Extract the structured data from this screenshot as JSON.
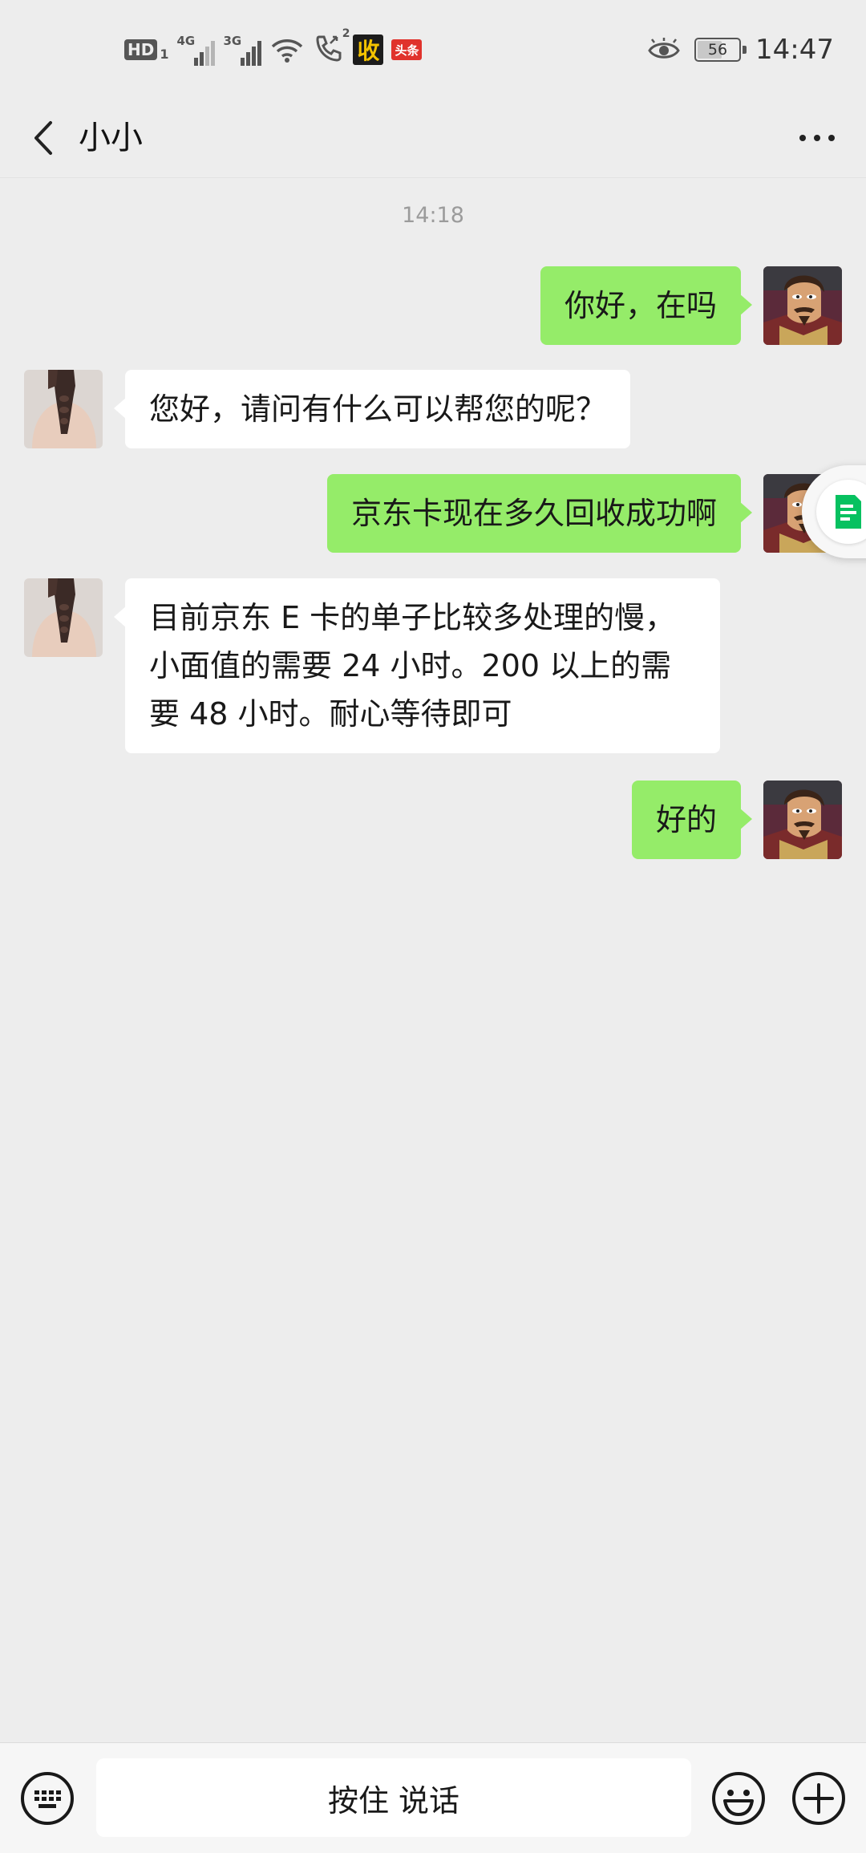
{
  "status_bar": {
    "hd_label": "HD",
    "hd_sim": "1",
    "signal1_gen": "4G",
    "signal2_gen": "3G",
    "call_badge": "2",
    "app_icon_1": "收",
    "app_icon_2": "头条",
    "battery_level": "56",
    "time": "14:47"
  },
  "header": {
    "title": "小小"
  },
  "chat": {
    "time_divider": "14:18",
    "messages": [
      {
        "side": "self",
        "text": "你好，在吗"
      },
      {
        "side": "other",
        "text": "您好，请问有什么可以帮您的呢？"
      },
      {
        "side": "self",
        "text": "京东卡现在多久回收成功啊"
      },
      {
        "side": "other",
        "text": "目前京东 E 卡的单子比较多处理的慢，小面值的需要 24 小时。200 以上的需要 48 小时。耐心等待即可"
      },
      {
        "side": "self",
        "text": "好的"
      }
    ]
  },
  "input_bar": {
    "voice_label": "按住 说话"
  },
  "icons": {
    "back": "chevron-left-icon",
    "more": "more-dots-icon",
    "keyboard": "keyboard-icon",
    "emoji": "emoji-icon",
    "plus": "plus-icon",
    "float": "document-icon"
  },
  "colors": {
    "background": "#ededed",
    "outgoing_bubble": "#95ec69",
    "incoming_bubble": "#ffffff",
    "float_icon": "#07c160"
  }
}
